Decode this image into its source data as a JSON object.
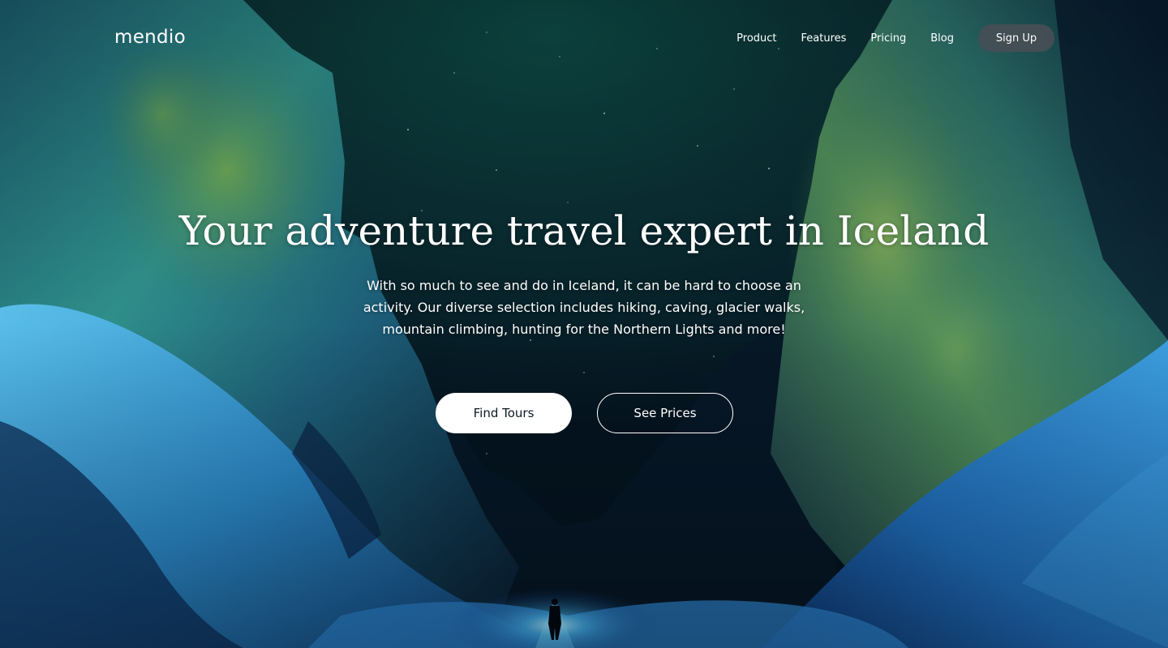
{
  "brand": {
    "logo_text": "mendio"
  },
  "nav": {
    "links": [
      {
        "label": "Product"
      },
      {
        "label": "Features"
      },
      {
        "label": "Pricing"
      },
      {
        "label": "Blog"
      }
    ],
    "signup_label": "Sign Up"
  },
  "hero": {
    "title": "Your adventure travel expert in Iceland",
    "subtitle": "With so much to see and do in Iceland, it can be hard to choose an activity. Our diverse selection includes hiking, caving, glacier walks, mountain climbing, hunting for the Northern Lights and more!",
    "primary_cta": "Find Tours",
    "secondary_cta": "See Prices",
    "background_image": "night canyon with glowing cliffs, snow and a lone hiker with a headlamp"
  },
  "colors": {
    "sky": "#0b3a3c",
    "night": "#03111f",
    "cliff_glow": "#3fa7c4",
    "moss": "#6f9a3a",
    "snow": "#4aa8e0",
    "signup_bg": "#464e56",
    "button_text_dark": "#0c1a24"
  }
}
